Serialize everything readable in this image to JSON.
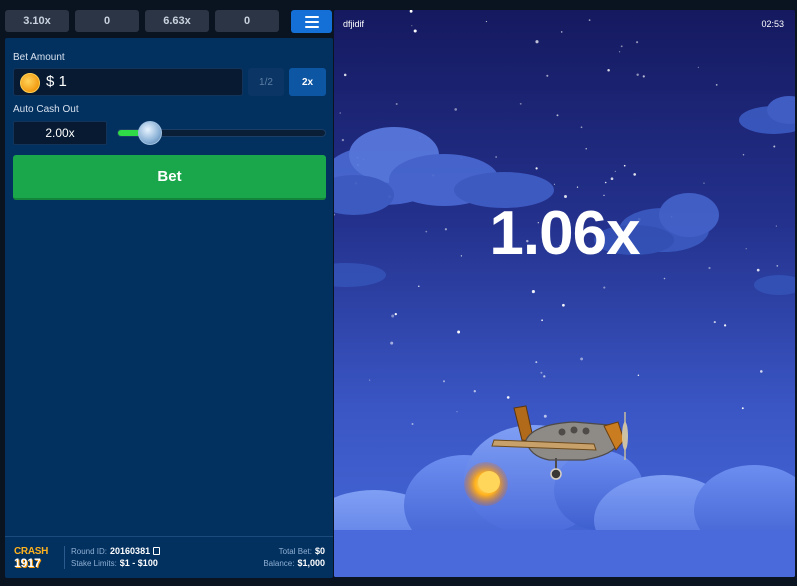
{
  "history": [
    "3.10x",
    "0",
    "6.63x",
    "0"
  ],
  "menu": {
    "icon": "hamburger-menu-icon"
  },
  "bet_panel": {
    "bet_amount_label": "Bet Amount",
    "currency_icon": "coin-icon",
    "bet_amount_value": "$ 1",
    "half_label": "1/2",
    "double_label": "2x",
    "auto_cashout_label": "Auto Cash Out",
    "auto_cashout_value": "2.00x",
    "auto_cashout_slider_fraction": 0.1,
    "bet_button_label": "Bet"
  },
  "footer": {
    "logo_line1": "CRASH",
    "logo_line2": "1917",
    "round_id_label": "Round ID:",
    "round_id_value": "20160381",
    "stake_limits_label": "Stake Limits:",
    "stake_limits_value": "$1 - $100",
    "total_bet_label": "Total Bet:",
    "total_bet_value": "$0",
    "balance_label": "Balance:",
    "balance_value": "$1,000"
  },
  "game": {
    "player_name": "dfjidif",
    "clock": "02:53",
    "multiplier": "1.06x"
  },
  "colors": {
    "accent_blue": "#1470d6",
    "bet_green": "#1aa64a",
    "panel_bg": "#02305f",
    "slider_green": "#2fdc48",
    "logo_orange": "#ffb21e"
  }
}
